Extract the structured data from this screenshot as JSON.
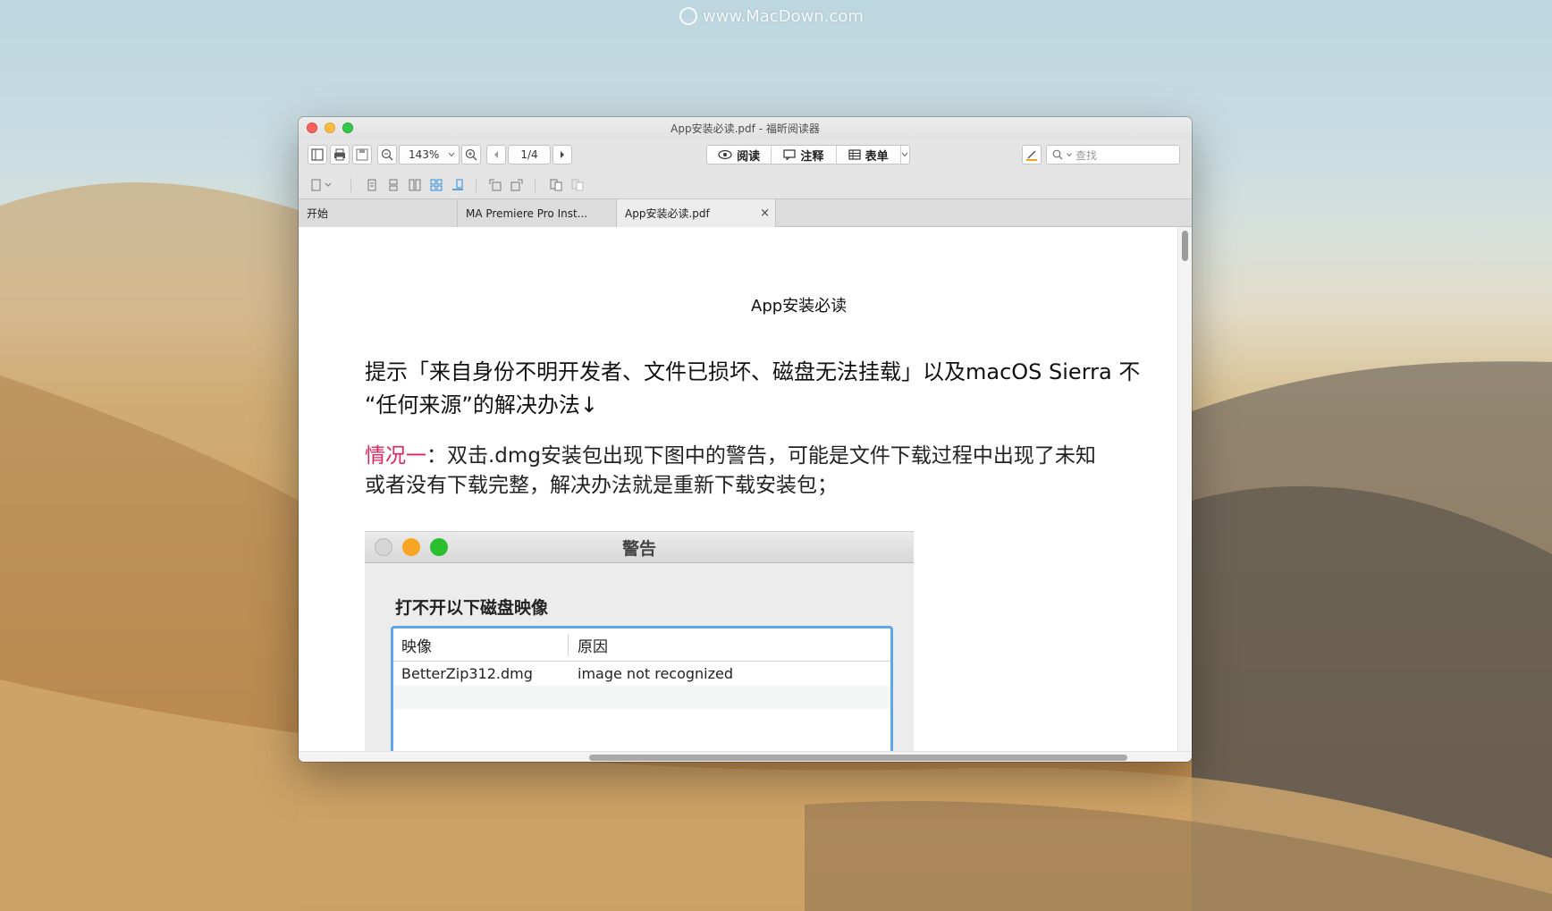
{
  "watermark": {
    "text": "www.MacDown.com"
  },
  "window": {
    "title": "App安装必读.pdf - 福昕阅读器"
  },
  "toolbar": {
    "zoom_value": "143%",
    "page_value": "1/4",
    "read_label": "阅读",
    "annotate_label": "注释",
    "form_label": "表单",
    "search_placeholder": "查找"
  },
  "tabs": [
    {
      "label": "开始",
      "active": false
    },
    {
      "label": "MA Premiere Pro Inst...",
      "active": false
    },
    {
      "label": "App安装必读.pdf",
      "active": true,
      "close": "×"
    }
  ],
  "document": {
    "title": "App安装必读",
    "paragraph1_line1": "提示「来自身份不明开发者、文件已损坏、磁盘无法挂载」以及macOS Sierra 不",
    "paragraph1_line2": "“任何来源”的解决办法↓",
    "paragraph2_label": "情况一",
    "paragraph2_line1_rest": "：双击.dmg安装包出现下图中的警告，可能是文件下载过程中出现了未知",
    "paragraph2_line2": "或者没有下载完整，解决办法就是重新下载安装包；",
    "screenshot": {
      "window_title": "警告",
      "heading": "打不开以下磁盘映像",
      "columns": [
        "映像",
        "原因"
      ],
      "rows": [
        [
          "BetterZip312.dmg",
          "image not recognized"
        ]
      ]
    }
  },
  "colors": {
    "accent_red": "#e0245e",
    "selection_blue": "#5fa7ec",
    "active_tool_blue": "#2f8fdc"
  },
  "icons": [
    "panel-icon",
    "print-icon",
    "save-icon",
    "zoom-out-icon",
    "zoom-in-icon",
    "prev-page-icon",
    "next-page-icon",
    "eye-icon",
    "comment-icon",
    "form-icon",
    "highlighter-icon",
    "search-icon",
    "page-icon",
    "single-page-icon",
    "continuous-icon",
    "facing-icon",
    "facing-continuous-icon",
    "cover-icon",
    "rotate-left-icon",
    "rotate-right-icon",
    "extract-icon",
    "insert-icon"
  ]
}
